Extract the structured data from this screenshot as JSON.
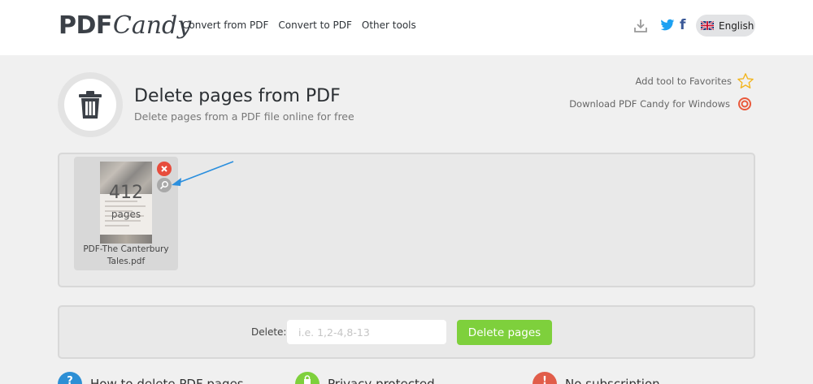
{
  "header": {
    "logo": {
      "part1": "PDF",
      "part2": "Candy"
    },
    "nav": [
      "Convert from PDF",
      "Convert to PDF",
      "Other tools"
    ],
    "social_icons": [
      "download-icon",
      "twitter-icon",
      "facebook-icon"
    ],
    "facebook_glyph": "f",
    "language": "English"
  },
  "tool": {
    "icon": "trash-icon",
    "title": "Delete pages from PDF",
    "subtitle": "Delete pages from a PDF file online for free",
    "favorites_label": "Add tool to Favorites",
    "download_windows_label": "Download PDF Candy for Windows"
  },
  "files": [
    {
      "name": "PDF-The Canterbury Tales.pdf",
      "page_count": "412",
      "page_word": "pages"
    }
  ],
  "action": {
    "delete_label": "Delete:",
    "input_placeholder": "i.e. 1,2-4,8-13",
    "input_value": "",
    "button_label": "Delete pages"
  },
  "features": [
    {
      "label": "How to delete PDF pages",
      "icon": "question-icon",
      "glyph": "?"
    },
    {
      "label": "Privacy protected",
      "icon": "lock-icon",
      "glyph": ""
    },
    {
      "label": "No subscription",
      "icon": "info-icon",
      "glyph": "!"
    }
  ],
  "colors": {
    "accent_green": "#7ed03c",
    "remove_red": "#e74c3c",
    "twitter_blue": "#1da1f2",
    "facebook_blue": "#3b5998",
    "feature_blue": "#2d8fd5",
    "feature_green": "#7ed03c",
    "feature_red": "#e15d4a",
    "arrow_blue": "#2b8fde"
  }
}
